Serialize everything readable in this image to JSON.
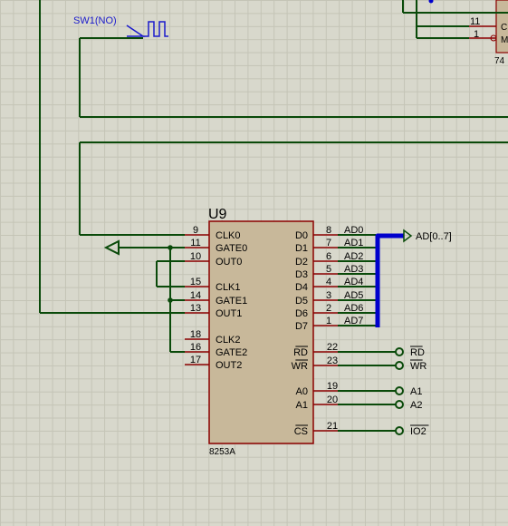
{
  "switch": {
    "label": "SW1(NO)"
  },
  "top_right_chip": {
    "pin_11": "11",
    "pin_1": "1",
    "pin_label_c": "C",
    "pin_label_m": "M",
    "part_fragment": "74"
  },
  "chip": {
    "ref": "U9",
    "part": "8253A",
    "left_pins": [
      {
        "num": "9",
        "name": "CLK0"
      },
      {
        "num": "11",
        "name": "GATE0"
      },
      {
        "num": "10",
        "name": "OUT0"
      },
      {
        "num": "15",
        "name": "CLK1"
      },
      {
        "num": "14",
        "name": "GATE1"
      },
      {
        "num": "13",
        "name": "OUT1"
      },
      {
        "num": "18",
        "name": "CLK2"
      },
      {
        "num": "16",
        "name": "GATE2"
      },
      {
        "num": "17",
        "name": "OUT2"
      }
    ],
    "data_pins": [
      {
        "num": "8",
        "name": "D0",
        "net": "AD0"
      },
      {
        "num": "7",
        "name": "D1",
        "net": "AD1"
      },
      {
        "num": "6",
        "name": "D2",
        "net": "AD2"
      },
      {
        "num": "5",
        "name": "D3",
        "net": "AD3"
      },
      {
        "num": "4",
        "name": "D4",
        "net": "AD4"
      },
      {
        "num": "3",
        "name": "D5",
        "net": "AD5"
      },
      {
        "num": "2",
        "name": "D6",
        "net": "AD6"
      },
      {
        "num": "1",
        "name": "D7",
        "net": "AD7"
      }
    ],
    "ctrl_pins": [
      {
        "num": "22",
        "name": "RD",
        "net": "RD"
      },
      {
        "num": "23",
        "name": "WR",
        "net": "WR"
      },
      {
        "num": "19",
        "name": "A0",
        "net": "A1"
      },
      {
        "num": "20",
        "name": "A1",
        "net": "A2"
      },
      {
        "num": "21",
        "name": "CS",
        "net": "IO2"
      }
    ]
  },
  "bus": {
    "label": "AD[0..7]"
  },
  "colors": {
    "wire": "#0a4a0a",
    "pin": "#8b0000",
    "body": "#c8b89a",
    "text": "#000000",
    "bus": "#0000cc",
    "switch": "#1a1acc"
  }
}
